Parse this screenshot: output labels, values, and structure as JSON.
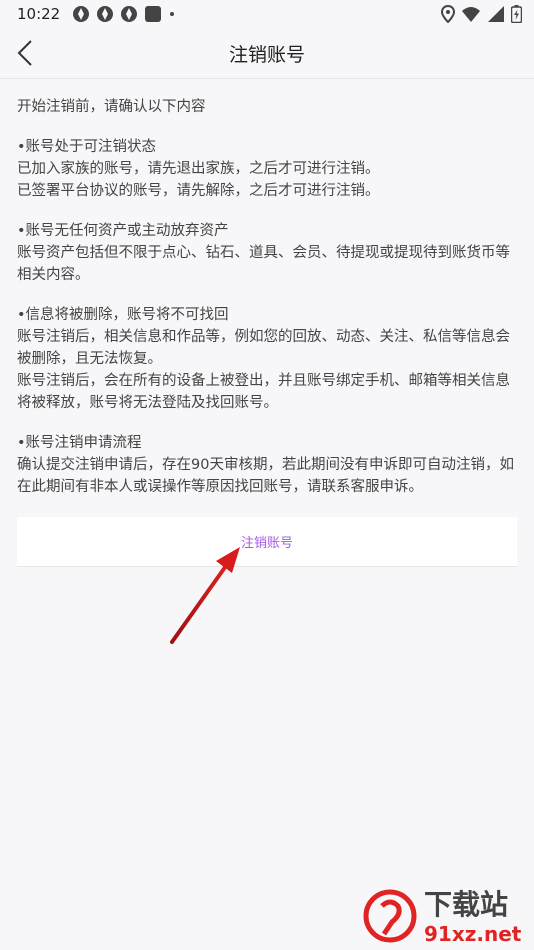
{
  "status_bar": {
    "time": "10:22"
  },
  "header": {
    "title": "注销账号"
  },
  "intro": "开始注销前，请确认以下内容",
  "sections": [
    {
      "heading": "•账号处于可注销状态",
      "lines": [
        "已加入家族的账号，请先退出家族，之后才可进行注销。",
        "已签署平台协议的账号，请先解除，之后才可进行注销。"
      ]
    },
    {
      "heading": "•账号无任何资产或主动放弃资产",
      "lines": [
        "账号资产包括但不限于点心、钻石、道具、会员、待提现或提现待到账货币等相关内容。"
      ]
    },
    {
      "heading": "•信息将被删除，账号将不可找回",
      "lines": [
        "账号注销后，相关信息和作品等，例如您的回放、动态、关注、私信等信息会被删除，且无法恢复。",
        "账号注销后，会在所有的设备上被登出，并且账号绑定手机、邮箱等相关信息将被释放，账号将无法登陆及找回账号。"
      ]
    },
    {
      "heading": "•账号注销申请流程",
      "lines": [
        "确认提交注销申请后，存在90天审核期，若此期间没有申诉即可自动注销，如在此期间有非本人或误操作等原因找回账号，请联系客服申诉。"
      ]
    }
  ],
  "action": {
    "label": "注销账号"
  },
  "watermark": {
    "line1": "下载站",
    "line2": "91xz.net"
  }
}
